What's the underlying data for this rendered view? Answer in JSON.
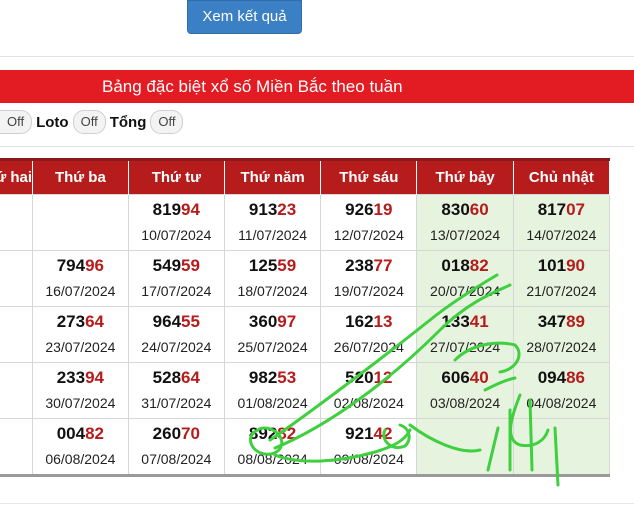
{
  "submit_label": "Xem kết quả",
  "banner_title": "Bảng đặc biệt xổ số Miền Bắc theo tuần",
  "toggles": [
    {
      "state": "Off",
      "label": "Loto"
    },
    {
      "state": "Off",
      "label": "Tổng"
    },
    {
      "state": "Off"
    }
  ],
  "columns": [
    "Thứ hai",
    "Thứ ba",
    "Thứ tư",
    "Thứ năm",
    "Thứ sáu",
    "Thứ bảy",
    "Chủ nhật"
  ],
  "rows": [
    [
      {
        "head": "",
        "tail": "",
        "date": ""
      },
      {
        "head": "",
        "tail": "",
        "date": ""
      },
      {
        "head": "819",
        "tail": "94",
        "date": "10/07/2024"
      },
      {
        "head": "913",
        "tail": "23",
        "date": "11/07/2024"
      },
      {
        "head": "926",
        "tail": "19",
        "date": "12/07/2024"
      },
      {
        "head": "830",
        "tail": "60",
        "date": "13/07/2024"
      },
      {
        "head": "817",
        "tail": "07",
        "date": "14/07/2024"
      }
    ],
    [
      {
        "head": "",
        "tail": "",
        "date": ""
      },
      {
        "head": "794",
        "tail": "96",
        "date": "16/07/2024"
      },
      {
        "head": "549",
        "tail": "59",
        "date": "17/07/2024"
      },
      {
        "head": "125",
        "tail": "59",
        "date": "18/07/2024"
      },
      {
        "head": "238",
        "tail": "77",
        "date": "19/07/2024"
      },
      {
        "head": "018",
        "tail": "82",
        "date": "20/07/2024"
      },
      {
        "head": "101",
        "tail": "90",
        "date": "21/07/2024"
      }
    ],
    [
      {
        "head": "",
        "tail": "",
        "date": ""
      },
      {
        "head": "273",
        "tail": "64",
        "date": "23/07/2024"
      },
      {
        "head": "964",
        "tail": "55",
        "date": "24/07/2024"
      },
      {
        "head": "360",
        "tail": "97",
        "date": "25/07/2024"
      },
      {
        "head": "162",
        "tail": "13",
        "date": "26/07/2024"
      },
      {
        "head": "133",
        "tail": "41",
        "date": "27/07/2024"
      },
      {
        "head": "347",
        "tail": "89",
        "date": "28/07/2024"
      }
    ],
    [
      {
        "head": "",
        "tail": "",
        "date": ""
      },
      {
        "head": "233",
        "tail": "94",
        "date": "30/07/2024"
      },
      {
        "head": "528",
        "tail": "64",
        "date": "31/07/2024"
      },
      {
        "head": "982",
        "tail": "53",
        "date": "01/08/2024"
      },
      {
        "head": "520",
        "tail": "12",
        "date": "02/08/2024"
      },
      {
        "head": "606",
        "tail": "40",
        "date": "03/08/2024"
      },
      {
        "head": "094",
        "tail": "86",
        "date": "04/08/2024"
      }
    ],
    [
      {
        "head": "",
        "tail": "",
        "date": ""
      },
      {
        "head": "004",
        "tail": "82",
        "date": "06/08/2024"
      },
      {
        "head": "260",
        "tail": "70",
        "date": "07/08/2024"
      },
      {
        "head": "892",
        "tail": "82",
        "date": "08/08/2024"
      },
      {
        "head": "921",
        "tail": "42",
        "date": "09/08/2024"
      },
      {
        "head": "",
        "tail": "",
        "date": ""
      },
      {
        "head": "",
        "tail": "",
        "date": ""
      }
    ]
  ],
  "colors": {
    "banner": "#e31b23",
    "header": "#b71c1c",
    "weekend_bg": "#e6f4df",
    "ink": "#3fcf3f",
    "button": "#3b7fc4"
  },
  "annotation_text": "141"
}
